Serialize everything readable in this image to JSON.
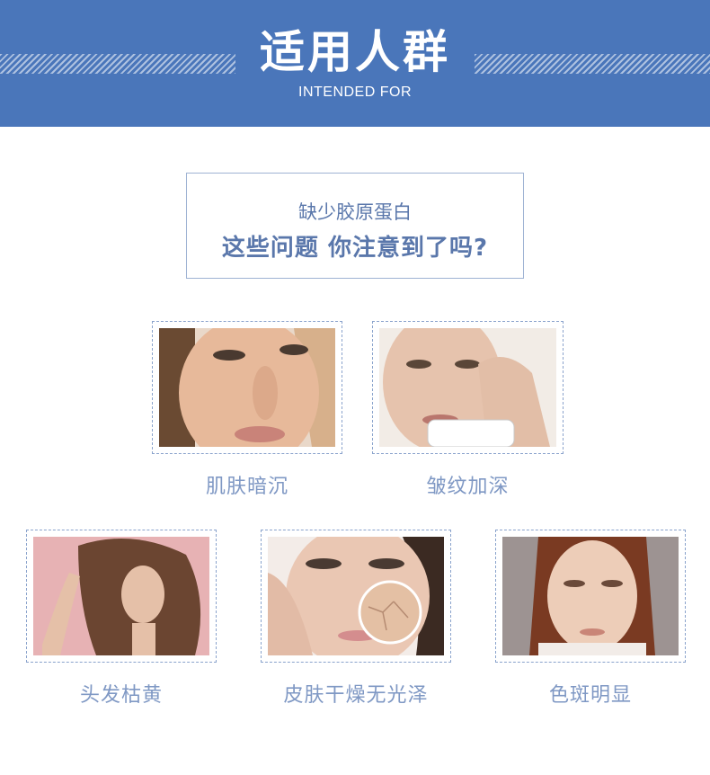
{
  "header": {
    "title": "适用人群",
    "subtitle": "INTENDED FOR"
  },
  "question": {
    "line1": "缺少胶原蛋白",
    "line2": "这些问题 你注意到了吗?"
  },
  "cards": [
    {
      "caption": "肌肤暗沉",
      "icon": "dull-skin-photo"
    },
    {
      "caption": "皱纹加深",
      "icon": "wrinkles-photo"
    },
    {
      "caption": "头发枯黄",
      "icon": "dry-hair-photo"
    },
    {
      "caption": "皮肤干燥无光泽",
      "icon": "dry-skin-photo"
    },
    {
      "caption": "色斑明显",
      "icon": "freckles-photo"
    }
  ],
  "colors": {
    "banner": "#4a76ba",
    "text_accent": "#5a77ab",
    "caption": "#7f98c4",
    "frame_border": "#8aa3cc"
  }
}
